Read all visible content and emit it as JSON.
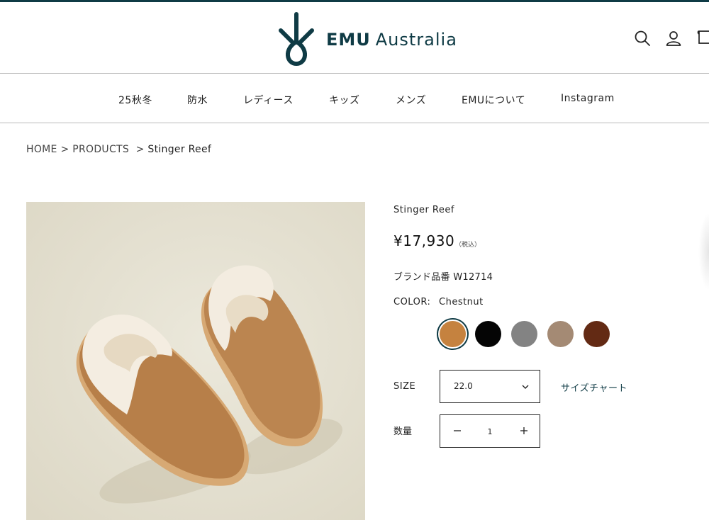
{
  "header": {
    "brand_bold": "EMU",
    "brand_light": "Australia",
    "icons": [
      "search-icon",
      "account-icon",
      "cart-icon"
    ]
  },
  "nav": {
    "items": [
      "25秋冬",
      "防水",
      "レディース",
      "キッズ",
      "メンズ",
      "EMUについて",
      "Instagram"
    ]
  },
  "breadcrumb": {
    "home": "HOME",
    "sep1": ">",
    "products": "PRODUCTS",
    "sep2": ">",
    "current": "Stinger Reef"
  },
  "product": {
    "title": "Stinger Reef",
    "price": "¥17,930",
    "tax_note": "（税込）",
    "sku": "ブランド品番 W12714",
    "color_label": "COLOR:",
    "color_value": "Chestnut",
    "swatches": [
      "#c5823f",
      "#050505",
      "#838383",
      "#a48a74",
      "#632a14"
    ],
    "selected_swatch": 0,
    "size_label": "SIZE",
    "size_value": "22.0",
    "size_chart_label": "サイズチャート",
    "qty_label": "数量",
    "qty_value": "1"
  },
  "colors": {
    "brand": "#0f3b45",
    "border": "#b9b9b9",
    "photo_bg": "#e7e3d5"
  }
}
